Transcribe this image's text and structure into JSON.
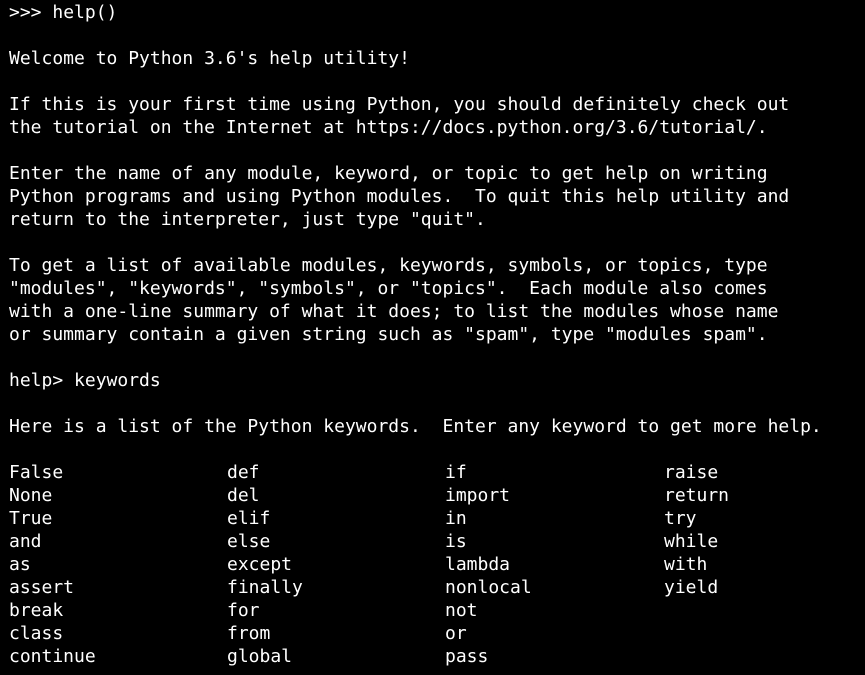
{
  "session": {
    "prompt_primary": ">>> ",
    "first_command": "help()",
    "welcome": "Welcome to Python 3.6's help utility!",
    "intro_lines": [
      "If this is your first time using Python, you should definitely check out",
      "the tutorial on the Internet at https://docs.python.org/3.6/tutorial/."
    ],
    "enter_lines": [
      "Enter the name of any module, keyword, or topic to get help on writing",
      "Python programs and using Python modules.  To quit this help utility and",
      "return to the interpreter, just type \"quit\"."
    ],
    "list_lines": [
      "To get a list of available modules, keywords, symbols, or topics, type",
      "\"modules\", \"keywords\", \"symbols\", or \"topics\".  Each module also comes",
      "with a one-line summary of what it does; to list the modules whose name",
      "or summary contain a given string such as \"spam\", type \"modules spam\"."
    ],
    "help_prompt": "help> ",
    "help_command": "keywords",
    "keywords_header": "Here is a list of the Python keywords.  Enter any keyword to get more help.",
    "keywords_rows": [
      [
        "False",
        "def",
        "if",
        "raise"
      ],
      [
        "None",
        "del",
        "import",
        "return"
      ],
      [
        "True",
        "elif",
        "in",
        "try"
      ],
      [
        "and",
        "else",
        "is",
        "while"
      ],
      [
        "as",
        "except",
        "lambda",
        "with"
      ],
      [
        "assert",
        "finally",
        "nonlocal",
        "yield"
      ],
      [
        "break",
        "for",
        "not",
        ""
      ],
      [
        "class",
        "from",
        "or",
        ""
      ],
      [
        "continue",
        "global",
        "pass",
        ""
      ]
    ]
  },
  "colors": {
    "background": "#000000",
    "foreground": "#ffffff"
  }
}
